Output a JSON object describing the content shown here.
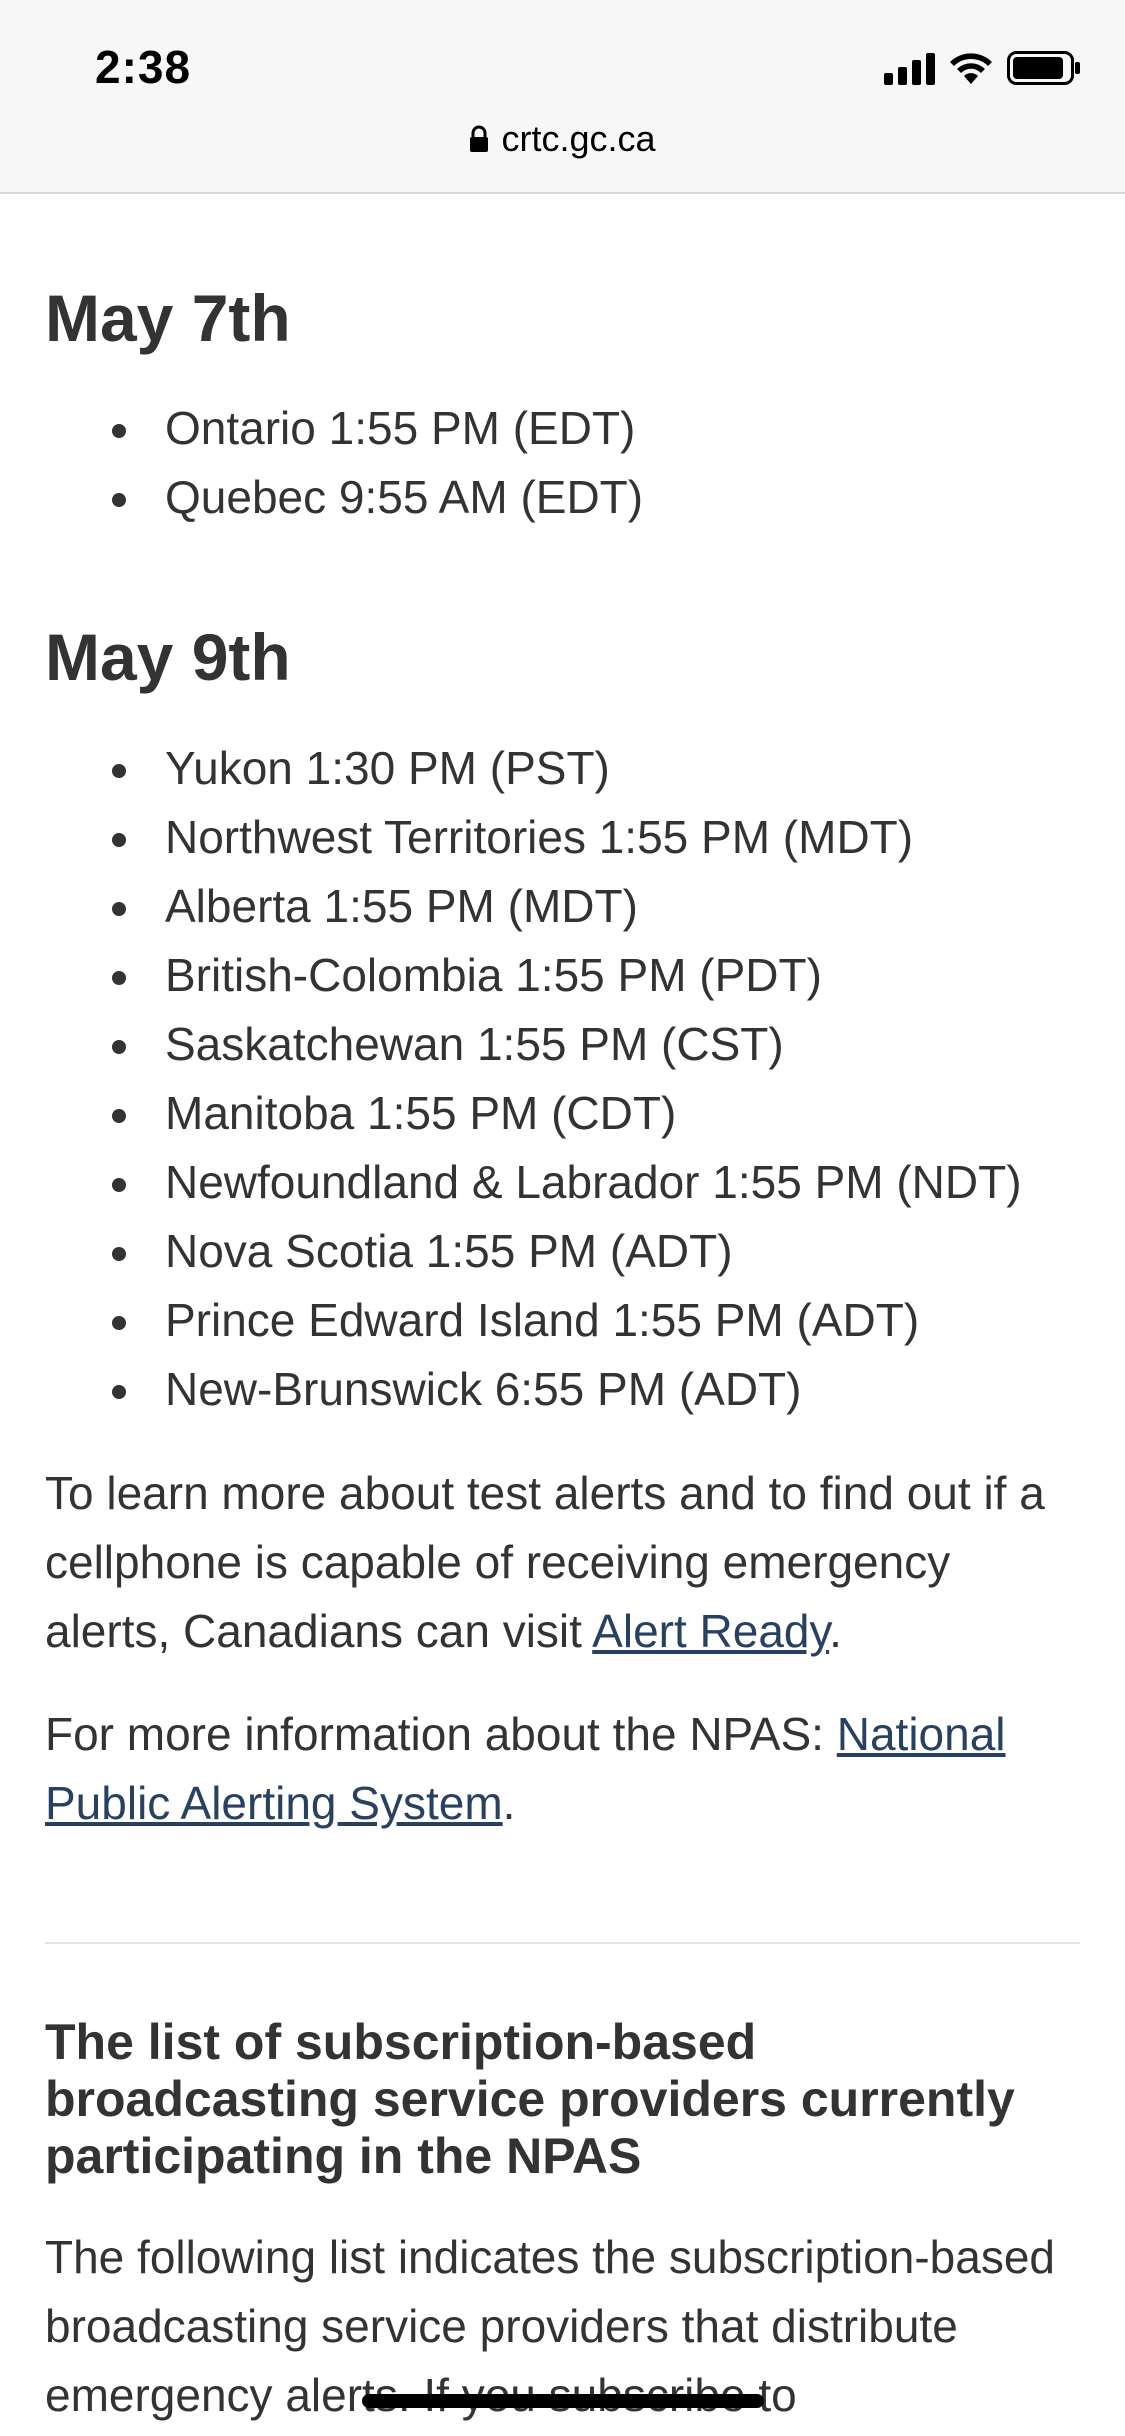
{
  "status_bar": {
    "time": "2:38"
  },
  "address_bar": {
    "url": "crtc.gc.ca"
  },
  "sections": [
    {
      "heading": "May 7th",
      "items": [
        "Ontario 1:55 PM (EDT)",
        "Quebec 9:55 AM (EDT)"
      ]
    },
    {
      "heading": "May 9th",
      "items": [
        "Yukon 1:30 PM (PST)",
        "Northwest Territories 1:55 PM (MDT)",
        "Alberta 1:55 PM (MDT)",
        "British-Colombia 1:55 PM (PDT)",
        "Saskatchewan 1:55 PM (CST)",
        "Manitoba 1:55 PM (CDT)",
        "Newfoundland & Labrador 1:55 PM (NDT)",
        "Nova Scotia 1:55 PM (ADT)",
        "Prince Edward Island 1:55 PM (ADT)",
        "New-Brunswick 6:55 PM (ADT)"
      ]
    }
  ],
  "learn_more": {
    "text": "To learn more about test alerts and to find out if a cellphone is capable of receiving emergency alerts, Canadians can visit ",
    "link": "Alert Ready",
    "end": "."
  },
  "npas_info": {
    "text": "For more information about the NPAS: ",
    "link": "National Public Alerting System",
    "end": "."
  },
  "providers_section": {
    "heading": "The list of subscription-based broadcasting service providers currently participating in the NPAS",
    "intro": "The following list indicates the subscription-based broadcasting service providers that distribute emergency alerts. If you subscribe to"
  },
  "colors": {
    "link": "#284162",
    "text": "#333333",
    "top_bar": "#f7f7f7"
  }
}
